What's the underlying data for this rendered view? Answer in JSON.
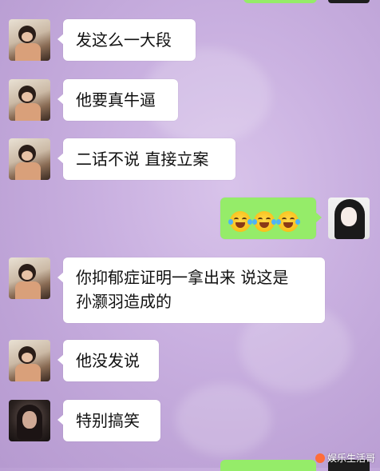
{
  "chat": {
    "messages": [
      {
        "side": "left",
        "avatar": "child-avatar",
        "text": "发这么一大段"
      },
      {
        "side": "left",
        "avatar": "child-avatar",
        "text": "他要真牛逼"
      },
      {
        "side": "left",
        "avatar": "child-avatar",
        "text": "二话不说 直接立案"
      },
      {
        "side": "right",
        "avatar": "anime-girl-avatar",
        "emojis": [
          "tears-of-joy-icon",
          "tears-of-joy-icon",
          "tears-of-joy-icon"
        ]
      },
      {
        "side": "left",
        "avatar": "child-avatar",
        "text_line1": "你抑郁症证明一拿出来 说这是",
        "text_line2": "孙灏羽造成的"
      },
      {
        "side": "left",
        "avatar": "child-avatar",
        "text": "他没发说"
      },
      {
        "side": "left",
        "avatar": "dark-hair-woman-avatar",
        "text": "特别搞笑"
      }
    ]
  },
  "watermark": {
    "text": "娱乐生活哥"
  },
  "colors": {
    "background": "#c9b0e0",
    "bubble_white": "#ffffff",
    "bubble_green": "#95ec69",
    "text": "#111111"
  }
}
